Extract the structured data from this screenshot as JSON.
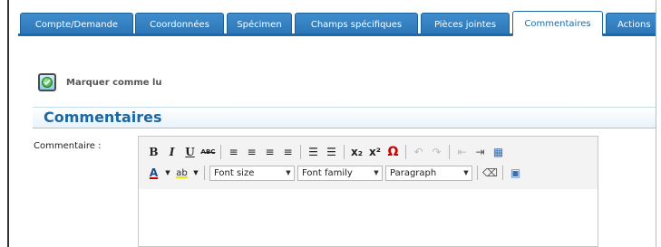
{
  "tabs": [
    {
      "label": "Compte/Demande",
      "active": false
    },
    {
      "label": "Coordonnées",
      "active": false
    },
    {
      "label": "Spécimen",
      "active": false
    },
    {
      "label": "Champs spécifiques",
      "active": false
    },
    {
      "label": "Pièces jointes",
      "active": false
    },
    {
      "label": "Commentaires",
      "active": true
    },
    {
      "label": "Actions",
      "active": false
    }
  ],
  "mark_read": {
    "label": "Marquer comme lu",
    "icon": "check-circle-icon"
  },
  "section": {
    "title": "Commentaires"
  },
  "comment_field": {
    "label": "Commentaire :",
    "value": ""
  },
  "editor": {
    "row1_buttons": {
      "bold": "B",
      "italic": "I",
      "underline": "U",
      "strikethrough": "ABC",
      "align_left": "≡",
      "align_center": "≡",
      "align_right": "≡",
      "align_justify": "≡",
      "bullet_list": "☰",
      "numbered_list": "☰",
      "subscript": "x₂",
      "superscript": "x²",
      "special_char": "Ω",
      "undo": "↶",
      "redo": "↷",
      "outdent": "⇤",
      "indent": "⇥",
      "table": "▦"
    },
    "row2_buttons": {
      "text_color": "A",
      "highlight": "ab",
      "eraser": "⌫",
      "image": "▣"
    },
    "font_size": "Font size",
    "font_family": "Font family",
    "format": "Paragraph"
  },
  "colors": {
    "tab_blue": "#2b74b6",
    "title_blue": "#1b68a6",
    "accent_red": "#cc0000"
  }
}
